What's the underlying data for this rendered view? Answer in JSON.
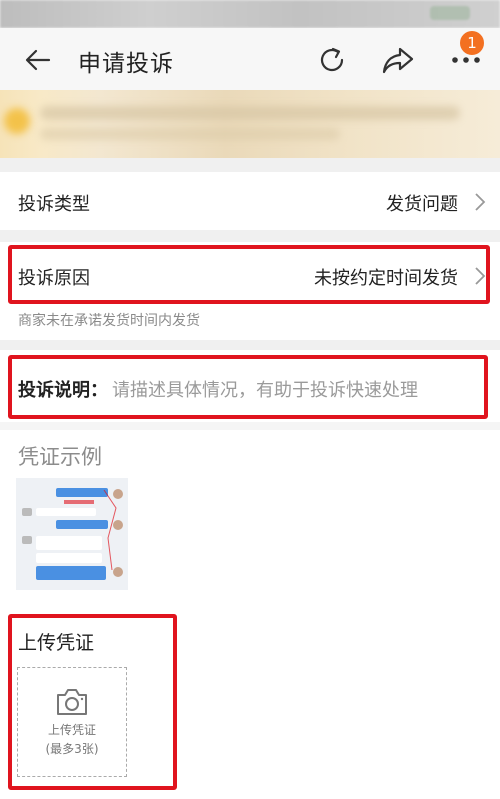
{
  "header": {
    "title": "申请投诉",
    "notification_count": "1"
  },
  "form": {
    "complaint_type": {
      "label": "投诉类型",
      "value": "发货问题"
    },
    "complaint_reason": {
      "label": "投诉原因",
      "value": "未按约定时间发货",
      "hint": "商家未在承诺发货时间内发货"
    },
    "complaint_desc": {
      "label": "投诉说明：",
      "placeholder": "请描述具体情况，有助于投诉快速处理"
    }
  },
  "evidence_example": {
    "title": "凭证示例"
  },
  "upload": {
    "title": "上传凭证",
    "button_line1": "上传凭证",
    "button_line2": "(最多3张)"
  },
  "colors": {
    "highlight_red": "#e0141e",
    "badge_orange": "#f37021"
  }
}
